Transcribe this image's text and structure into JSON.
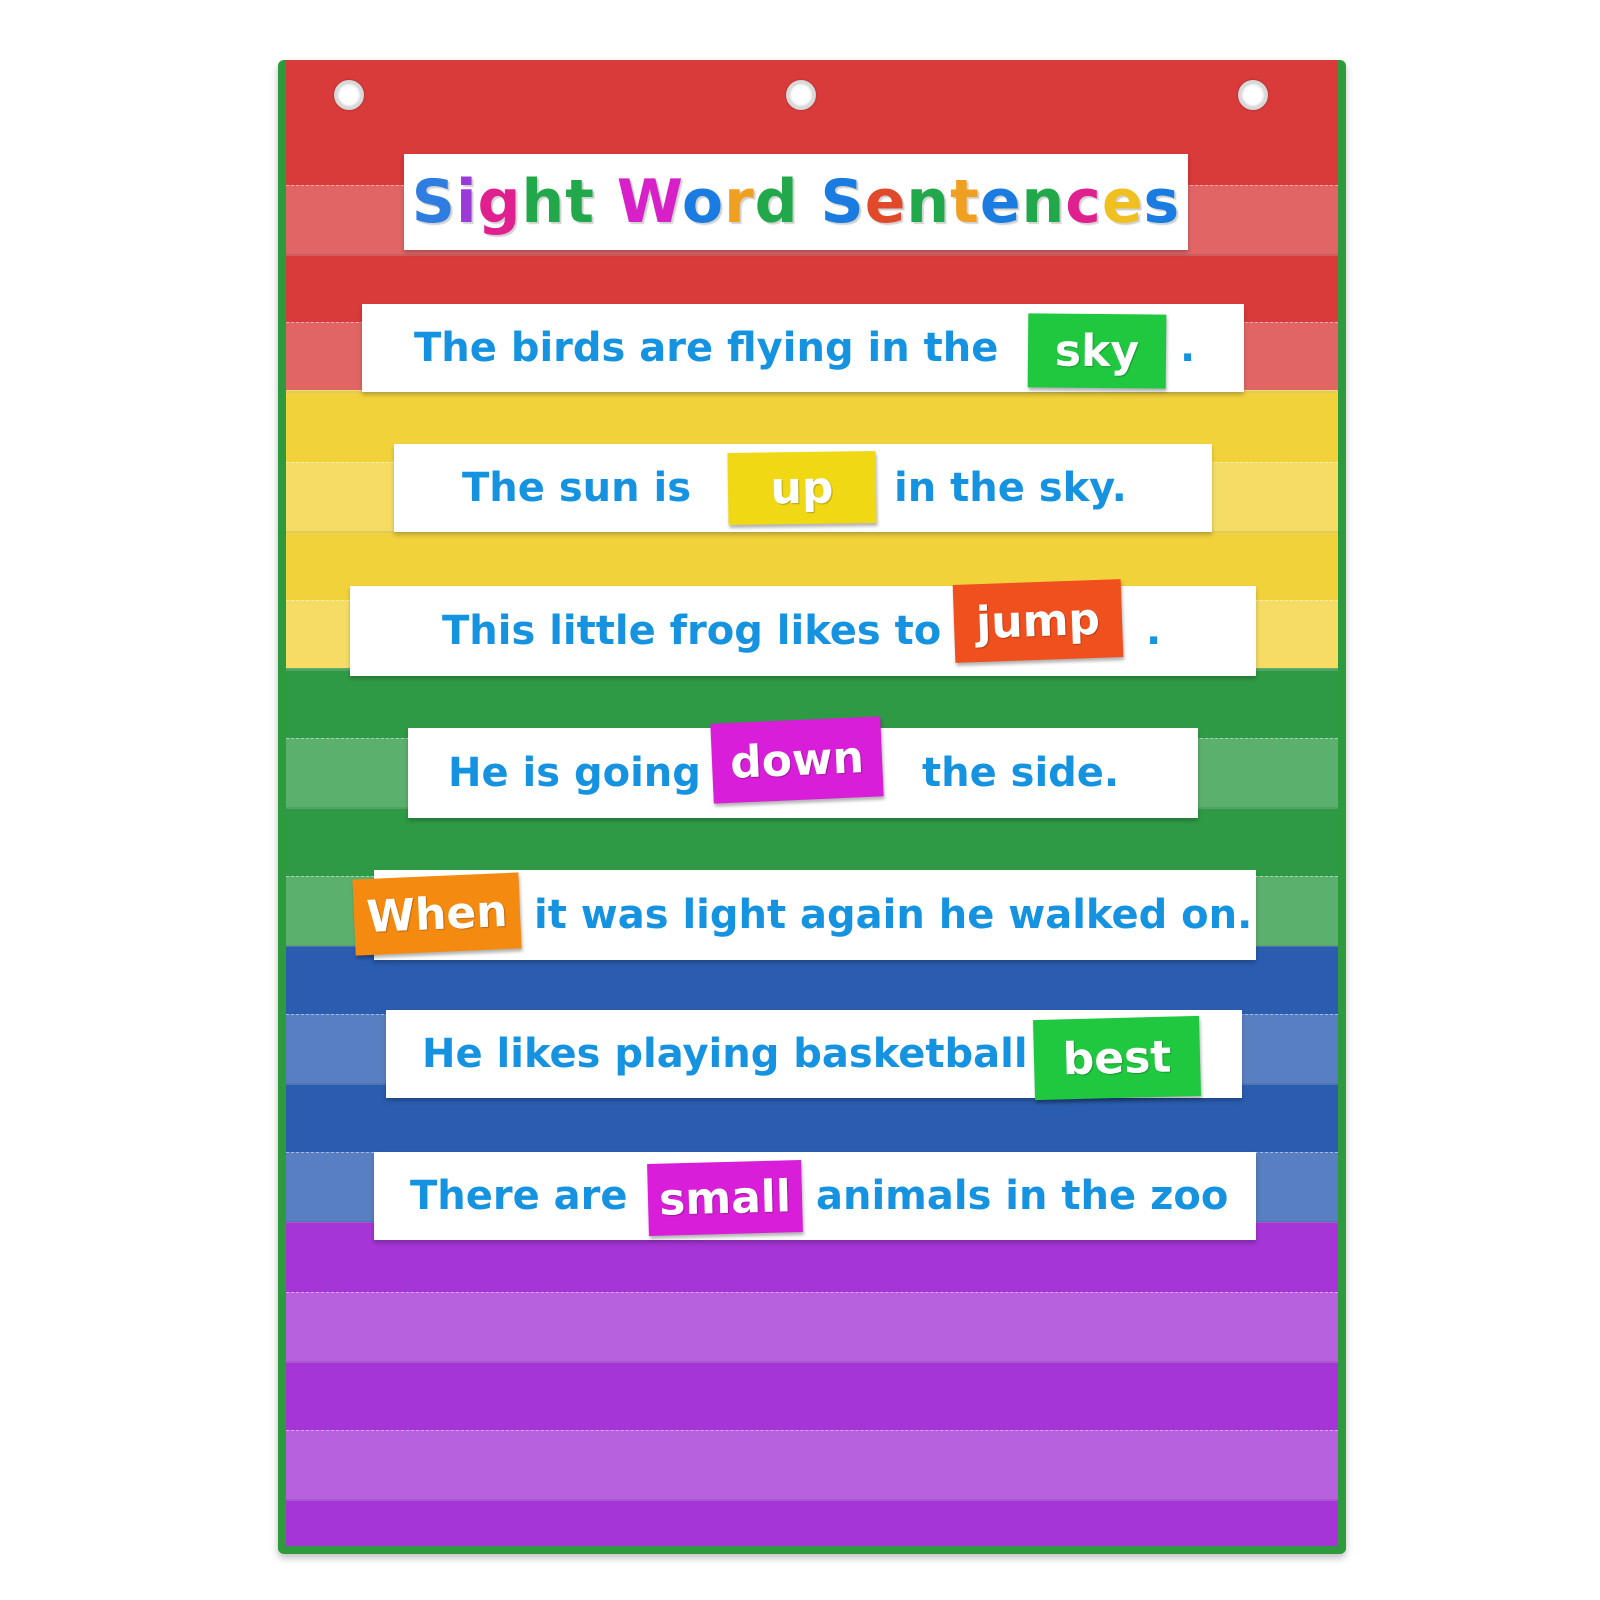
{
  "title": {
    "letters": [
      "S",
      "i",
      "g",
      "h",
      "t",
      " ",
      "W",
      "o",
      "r",
      "d",
      " ",
      "S",
      "e",
      "n",
      "t",
      "e",
      "n",
      "c",
      "e",
      "s"
    ],
    "letter_colors": [
      "#2f7de0",
      "#9b3ad8",
      "#e0208f",
      "#20a84a",
      "#20a84a",
      "#ffffff",
      "#d820c8",
      "#1a7be0",
      "#f0a020",
      "#20a84a",
      "#ffffff",
      "#1a7be0",
      "#e04a2a",
      "#20a84a",
      "#f0a020",
      "#1a7be0",
      "#20a84a",
      "#e0208f",
      "#f0c020",
      "#1a7be0"
    ]
  },
  "colors": {
    "red": "#d93a3a",
    "yellow": "#f2d23a",
    "green": "#2f9a45",
    "blue": "#2a5cb0",
    "purple": "#a535d6",
    "text_blue": "#1593e0",
    "frame_green": "#2e9a3e"
  },
  "sentences": [
    {
      "before": "The birds are flying in the",
      "word": "sky",
      "after": ".",
      "word_color": "#20c840"
    },
    {
      "before": "The sun is",
      "word": "up",
      "after": "in the sky.",
      "word_color": "#f0d815"
    },
    {
      "before": "This little frog likes to",
      "word": "jump",
      "after": ".",
      "word_color": "#f0501e"
    },
    {
      "before": "He is going",
      "word": "down",
      "after": "the side.",
      "word_color": "#d81ed8"
    },
    {
      "before": "",
      "word": "When",
      "after": "it was light again he walked on.",
      "word_color": "#f58a10"
    },
    {
      "before": "He likes playing basketball",
      "word": "best",
      "after": "",
      "word_color": "#20c840"
    },
    {
      "before": "There are",
      "word": "small",
      "after": "animals in the zoo",
      "word_color": "#d81ed8"
    }
  ],
  "icons": {
    "grommet": "grommet-icon"
  }
}
